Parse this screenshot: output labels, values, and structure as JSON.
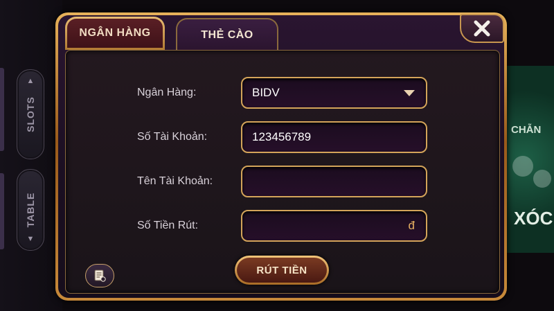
{
  "side_menu": {
    "slots": "SLOTS",
    "table": "TABLE"
  },
  "background": {
    "game_label_1": "CHẴN",
    "game_label_2": "XÓC"
  },
  "tabs": [
    {
      "label": "NGÂN HÀNG",
      "active": true
    },
    {
      "label": "THẺ CÀO",
      "active": false
    }
  ],
  "form": {
    "bank_label": "Ngân Hàng:",
    "bank_value": "BIDV",
    "account_number_label": "Số Tài Khoản:",
    "account_number_value": "123456789",
    "account_name_label": "Tên Tài Khoản:",
    "account_name_value": "",
    "amount_label": "Số Tiền Rút:",
    "amount_value": "",
    "currency_symbol": "đ"
  },
  "submit_label": "RÚT TIỀN",
  "icons": {
    "close": "close-icon",
    "dropdown": "caret-down-icon",
    "history": "history-icon"
  },
  "colors": {
    "gold": "#d4a45a",
    "panel": "#1a1419",
    "active_tab": "#4a161c"
  }
}
